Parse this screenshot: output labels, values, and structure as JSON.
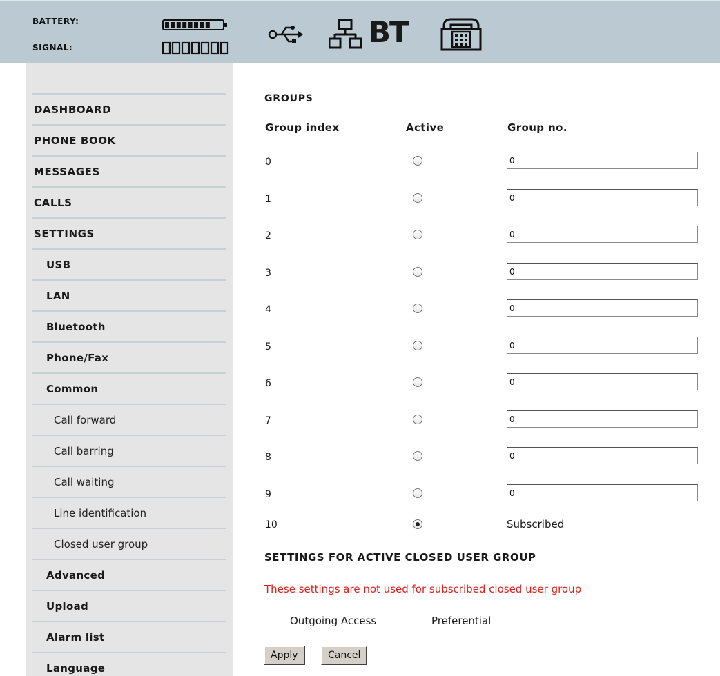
{
  "header": {
    "battery_label": "BATTERY:",
    "signal_label": "SIGNAL:",
    "battery_level": 0.8,
    "signal_bars_total": 7,
    "icons": [
      "usb-icon",
      "lan-icon",
      "bluetooth-icon",
      "phone-fax-icon"
    ],
    "bluetooth_text": "BT"
  },
  "sidebar": {
    "items": [
      {
        "label": "DASHBOARD",
        "level": 0
      },
      {
        "label": "PHONE BOOK",
        "level": 0
      },
      {
        "label": "MESSAGES",
        "level": 0
      },
      {
        "label": "CALLS",
        "level": 0
      },
      {
        "label": "SETTINGS",
        "level": 0
      },
      {
        "label": "USB",
        "level": 1
      },
      {
        "label": "LAN",
        "level": 1
      },
      {
        "label": "Bluetooth",
        "level": 1
      },
      {
        "label": "Phone/Fax",
        "level": 1
      },
      {
        "label": "Common",
        "level": 1
      },
      {
        "label": "Call forward",
        "level": 2
      },
      {
        "label": "Call barring",
        "level": 2
      },
      {
        "label": "Call waiting",
        "level": 2
      },
      {
        "label": "Line identification",
        "level": 2
      },
      {
        "label": "Closed user group",
        "level": 2
      },
      {
        "label": "Advanced",
        "level": 1
      },
      {
        "label": "Upload",
        "level": 1
      },
      {
        "label": "Alarm list",
        "level": 1
      },
      {
        "label": "Language",
        "level": 1
      }
    ]
  },
  "main": {
    "title": "GROUPS",
    "col_index": "Group index",
    "col_active": "Active",
    "col_group_no": "Group no.",
    "rows": [
      {
        "index": "0",
        "active": false,
        "group_no": "0"
      },
      {
        "index": "1",
        "active": false,
        "group_no": "0"
      },
      {
        "index": "2",
        "active": false,
        "group_no": "0"
      },
      {
        "index": "3",
        "active": false,
        "group_no": "0"
      },
      {
        "index": "4",
        "active": false,
        "group_no": "0"
      },
      {
        "index": "5",
        "active": false,
        "group_no": "0"
      },
      {
        "index": "6",
        "active": false,
        "group_no": "0"
      },
      {
        "index": "7",
        "active": false,
        "group_no": "0"
      },
      {
        "index": "8",
        "active": false,
        "group_no": "0"
      },
      {
        "index": "9",
        "active": false,
        "group_no": "0"
      }
    ],
    "subscribed_row": {
      "index": "10",
      "active": true,
      "text": "Subscribed"
    },
    "section_title": "SETTINGS FOR ACTIVE CLOSED USER GROUP",
    "warning": "These settings are not used for subscribed closed user group",
    "warning_color": "#e0201c",
    "outgoing_access_label": "Outgoing Access",
    "outgoing_access_checked": false,
    "preferential_label": "Preferential",
    "preferential_checked": false,
    "apply_label": "Apply",
    "cancel_label": "Cancel"
  }
}
